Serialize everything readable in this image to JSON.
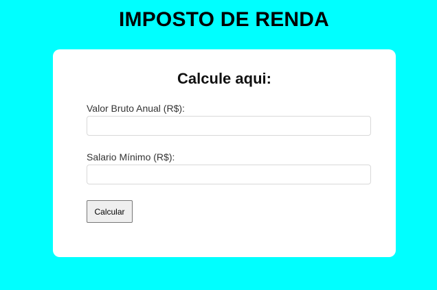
{
  "page": {
    "title": "IMPOSTO DE RENDA"
  },
  "form": {
    "heading": "Calcule aqui:",
    "fields": [
      {
        "label": "Valor Bruto Anual (R$):",
        "value": "",
        "placeholder": ""
      },
      {
        "label": "Salario Mínimo (R$):",
        "value": "",
        "placeholder": ""
      }
    ],
    "submit_label": "Calcular"
  },
  "colors": {
    "page_background": "#00ffff",
    "card_background": "#ffffff"
  }
}
